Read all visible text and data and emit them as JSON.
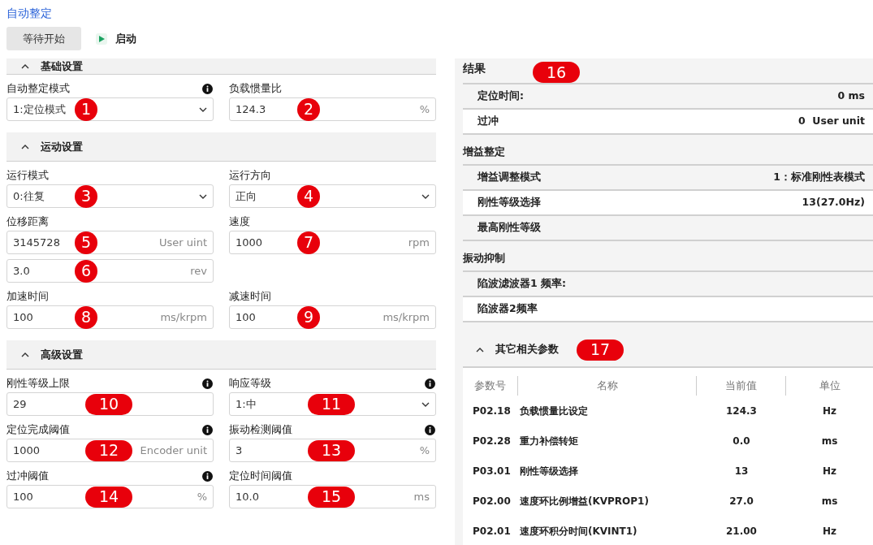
{
  "title": "自动整定",
  "toolbar": {
    "status_button": "等待开始",
    "start_button": "启动"
  },
  "sections": [
    {
      "title": "基础设置",
      "expanded": true,
      "rows": [
        [
          {
            "kind": "select",
            "label": "自动整定模式",
            "info": true,
            "value": "1:定位模式",
            "marker": "1"
          },
          {
            "kind": "input",
            "label": "负载惯量比",
            "info": false,
            "value": "124.3",
            "unit": "%",
            "marker": "2"
          }
        ]
      ]
    },
    {
      "title": "运动设置",
      "expanded": true,
      "rows": [
        [
          {
            "kind": "select",
            "label": "运行模式",
            "info": false,
            "value": "0:往复",
            "marker": "3"
          },
          {
            "kind": "select",
            "label": "运行方向",
            "info": false,
            "value": "正向",
            "marker": "4"
          }
        ],
        [
          {
            "kind": "input",
            "label": "位移距离",
            "info": false,
            "value": "3145728",
            "unit": "User uint",
            "marker": "5"
          },
          {
            "kind": "input",
            "label": "速度",
            "info": false,
            "value": "1000",
            "unit": "rpm",
            "marker": "7"
          }
        ],
        [
          {
            "kind": "input",
            "value": "3.0",
            "unit": "rev",
            "marker": "6"
          }
        ],
        [
          {
            "kind": "input",
            "label": "加速时间",
            "info": false,
            "value": "100",
            "unit": "ms/krpm",
            "marker": "8"
          },
          {
            "kind": "input",
            "label": "减速时间",
            "info": false,
            "value": "100",
            "unit": "ms/krpm",
            "marker": "9"
          }
        ]
      ]
    },
    {
      "title": "高级设置",
      "expanded": true,
      "rows": [
        [
          {
            "kind": "input",
            "label": "刚性等级上限",
            "info": true,
            "value": "29",
            "marker": "10"
          },
          {
            "kind": "select",
            "label": "响应等级",
            "info": true,
            "value": "1:中",
            "marker": "11"
          }
        ],
        [
          {
            "kind": "input",
            "label": "定位完成阈值",
            "info": true,
            "value": "1000",
            "unit": "Encoder unit",
            "marker": "12"
          },
          {
            "kind": "input",
            "label": "振动检测阈值",
            "info": true,
            "value": "3",
            "unit": "%",
            "marker": "13"
          }
        ],
        [
          {
            "kind": "input",
            "label": "过冲阈值",
            "info": true,
            "value": "100",
            "unit": "%",
            "marker": "14"
          },
          {
            "kind": "input",
            "label": "定位时间阈值",
            "info": false,
            "value": "10.0",
            "unit": "ms",
            "marker": "15"
          }
        ]
      ]
    }
  ],
  "results": {
    "title": "结果",
    "marker": "16",
    "groups": [
      {
        "rows": [
          {
            "label": "定位时间:",
            "value": "0 ms"
          },
          {
            "label": "过冲",
            "value": "0  User unit"
          }
        ]
      },
      {
        "title": "增益整定",
        "rows": [
          {
            "label": "增益调整模式",
            "value": "1：标准刚性表模式"
          },
          {
            "label": "刚性等级选择",
            "value": "13(27.0Hz)"
          },
          {
            "label": "最高刚性等级"
          }
        ]
      },
      {
        "title": "振动抑制",
        "rows": [
          {
            "label": "陷波滤波器1 频率:"
          },
          {
            "label": "陷波器2频率"
          }
        ]
      }
    ]
  },
  "params": {
    "title": "其它相关参数",
    "expanded": true,
    "marker": "17",
    "columns": [
      "参数号",
      "名称",
      "当前值",
      "单位"
    ],
    "rows": [
      [
        "P02.18",
        "负载惯量比设定",
        "124.3",
        "Hz"
      ],
      [
        "P02.28",
        "重力补偿转矩",
        "0.0",
        "ms"
      ],
      [
        "P03.01",
        "刚性等级选择",
        "13",
        "Hz"
      ],
      [
        "P02.00",
        "速度环比例增益(KVPROP1)",
        "27.0",
        "ms"
      ],
      [
        "P02.01",
        "速度环积分时间(KVINT1)",
        "21.00",
        "Hz"
      ]
    ]
  }
}
